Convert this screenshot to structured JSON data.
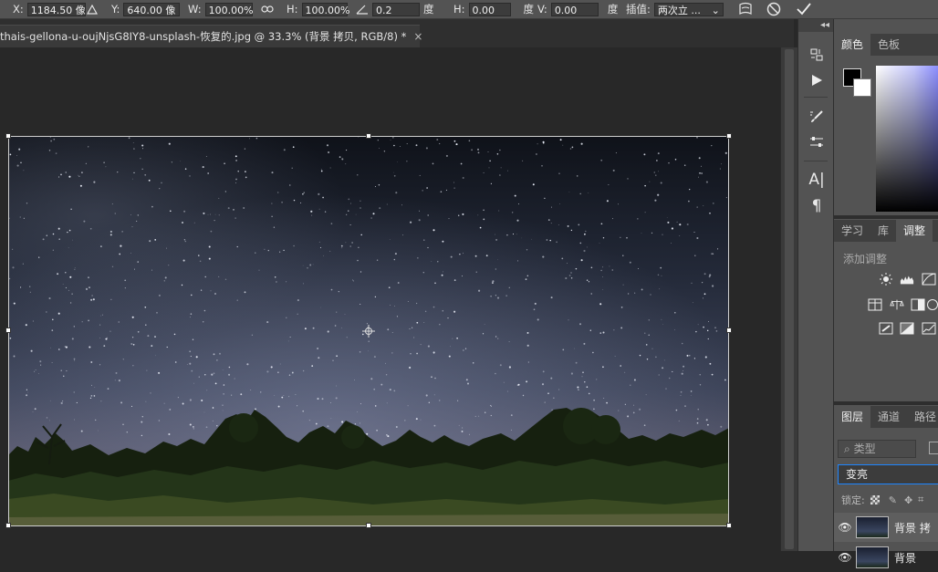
{
  "options_bar": {
    "x_label": "X:",
    "x_value": "1184.50 像",
    "y_label": "Y:",
    "y_value": "640.00 像",
    "w_label": "W:",
    "w_value": "100.00%",
    "h_label": "H:",
    "h_value": "100.00%",
    "angle_value": "0.2",
    "angle_unit": "度",
    "hskew_label": "H:",
    "hskew_value": "0.00",
    "hskew_unit": "度",
    "vskew_label": "V:",
    "vskew_value": "0.00",
    "vskew_unit": "度",
    "interp_label": "插值:",
    "interp_value": "两次立 ..."
  },
  "document": {
    "tab_title": "thais-gellona-u-oujNjsG8IY8-unsplash-恢复的.jpg @ 33.3% (背景 拷贝, RGB/8) *",
    "tab_close": "×"
  },
  "tools_header": "◂◂",
  "color_panel": {
    "tabs": [
      "颜色",
      "色板"
    ]
  },
  "adjust_panel": {
    "tabs": [
      "学习",
      "库",
      "调整"
    ],
    "heading": "添加调整"
  },
  "layers_panel": {
    "tabs": [
      "图层",
      "通道",
      "路径"
    ],
    "search_value": "类型",
    "blend_mode": "变亮",
    "lock_label": "锁定:",
    "layers": [
      {
        "name": "背景 拷"
      },
      {
        "name": "背景"
      }
    ]
  }
}
